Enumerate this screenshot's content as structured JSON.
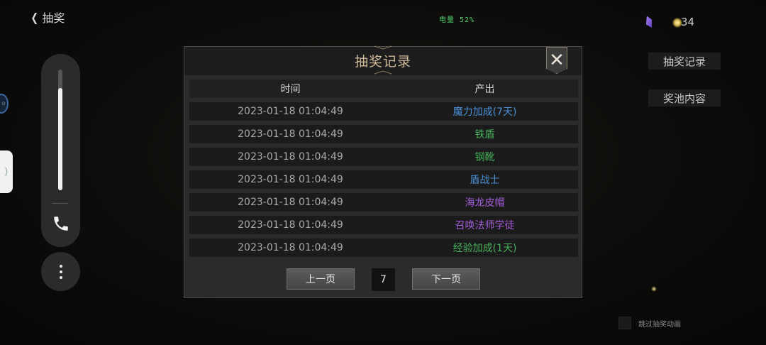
{
  "topbar": {
    "back_label": "抽奖",
    "battery_text": "电量 52%",
    "currency_count": "34"
  },
  "side_buttons": {
    "records": "抽奖记录",
    "pool": "奖池内容"
  },
  "skip_label": "跳过抽奖动画",
  "slider": {
    "level": 0.85
  },
  "modal": {
    "title": "抽奖记录",
    "columns": [
      "时间",
      "产出"
    ],
    "rows": [
      {
        "time": "2023-01-18 01:04:49",
        "item": "魔力加成(7天)",
        "color": "#4a8fd8"
      },
      {
        "time": "2023-01-18 01:04:49",
        "item": "铁盾",
        "color": "#46b05a"
      },
      {
        "time": "2023-01-18 01:04:49",
        "item": "钢靴",
        "color": "#46b05a"
      },
      {
        "time": "2023-01-18 01:04:49",
        "item": "盾战士",
        "color": "#4a8fd8"
      },
      {
        "time": "2023-01-18 01:04:49",
        "item": "海龙皮帽",
        "color": "#a35cd8"
      },
      {
        "time": "2023-01-18 01:04:49",
        "item": "召唤法师学徒",
        "color": "#a35cd8"
      },
      {
        "time": "2023-01-18 01:04:49",
        "item": "经验加成(1天)",
        "color": "#46b05a"
      }
    ],
    "pager": {
      "prev": "上一页",
      "page": "7",
      "next": "下一页"
    }
  }
}
